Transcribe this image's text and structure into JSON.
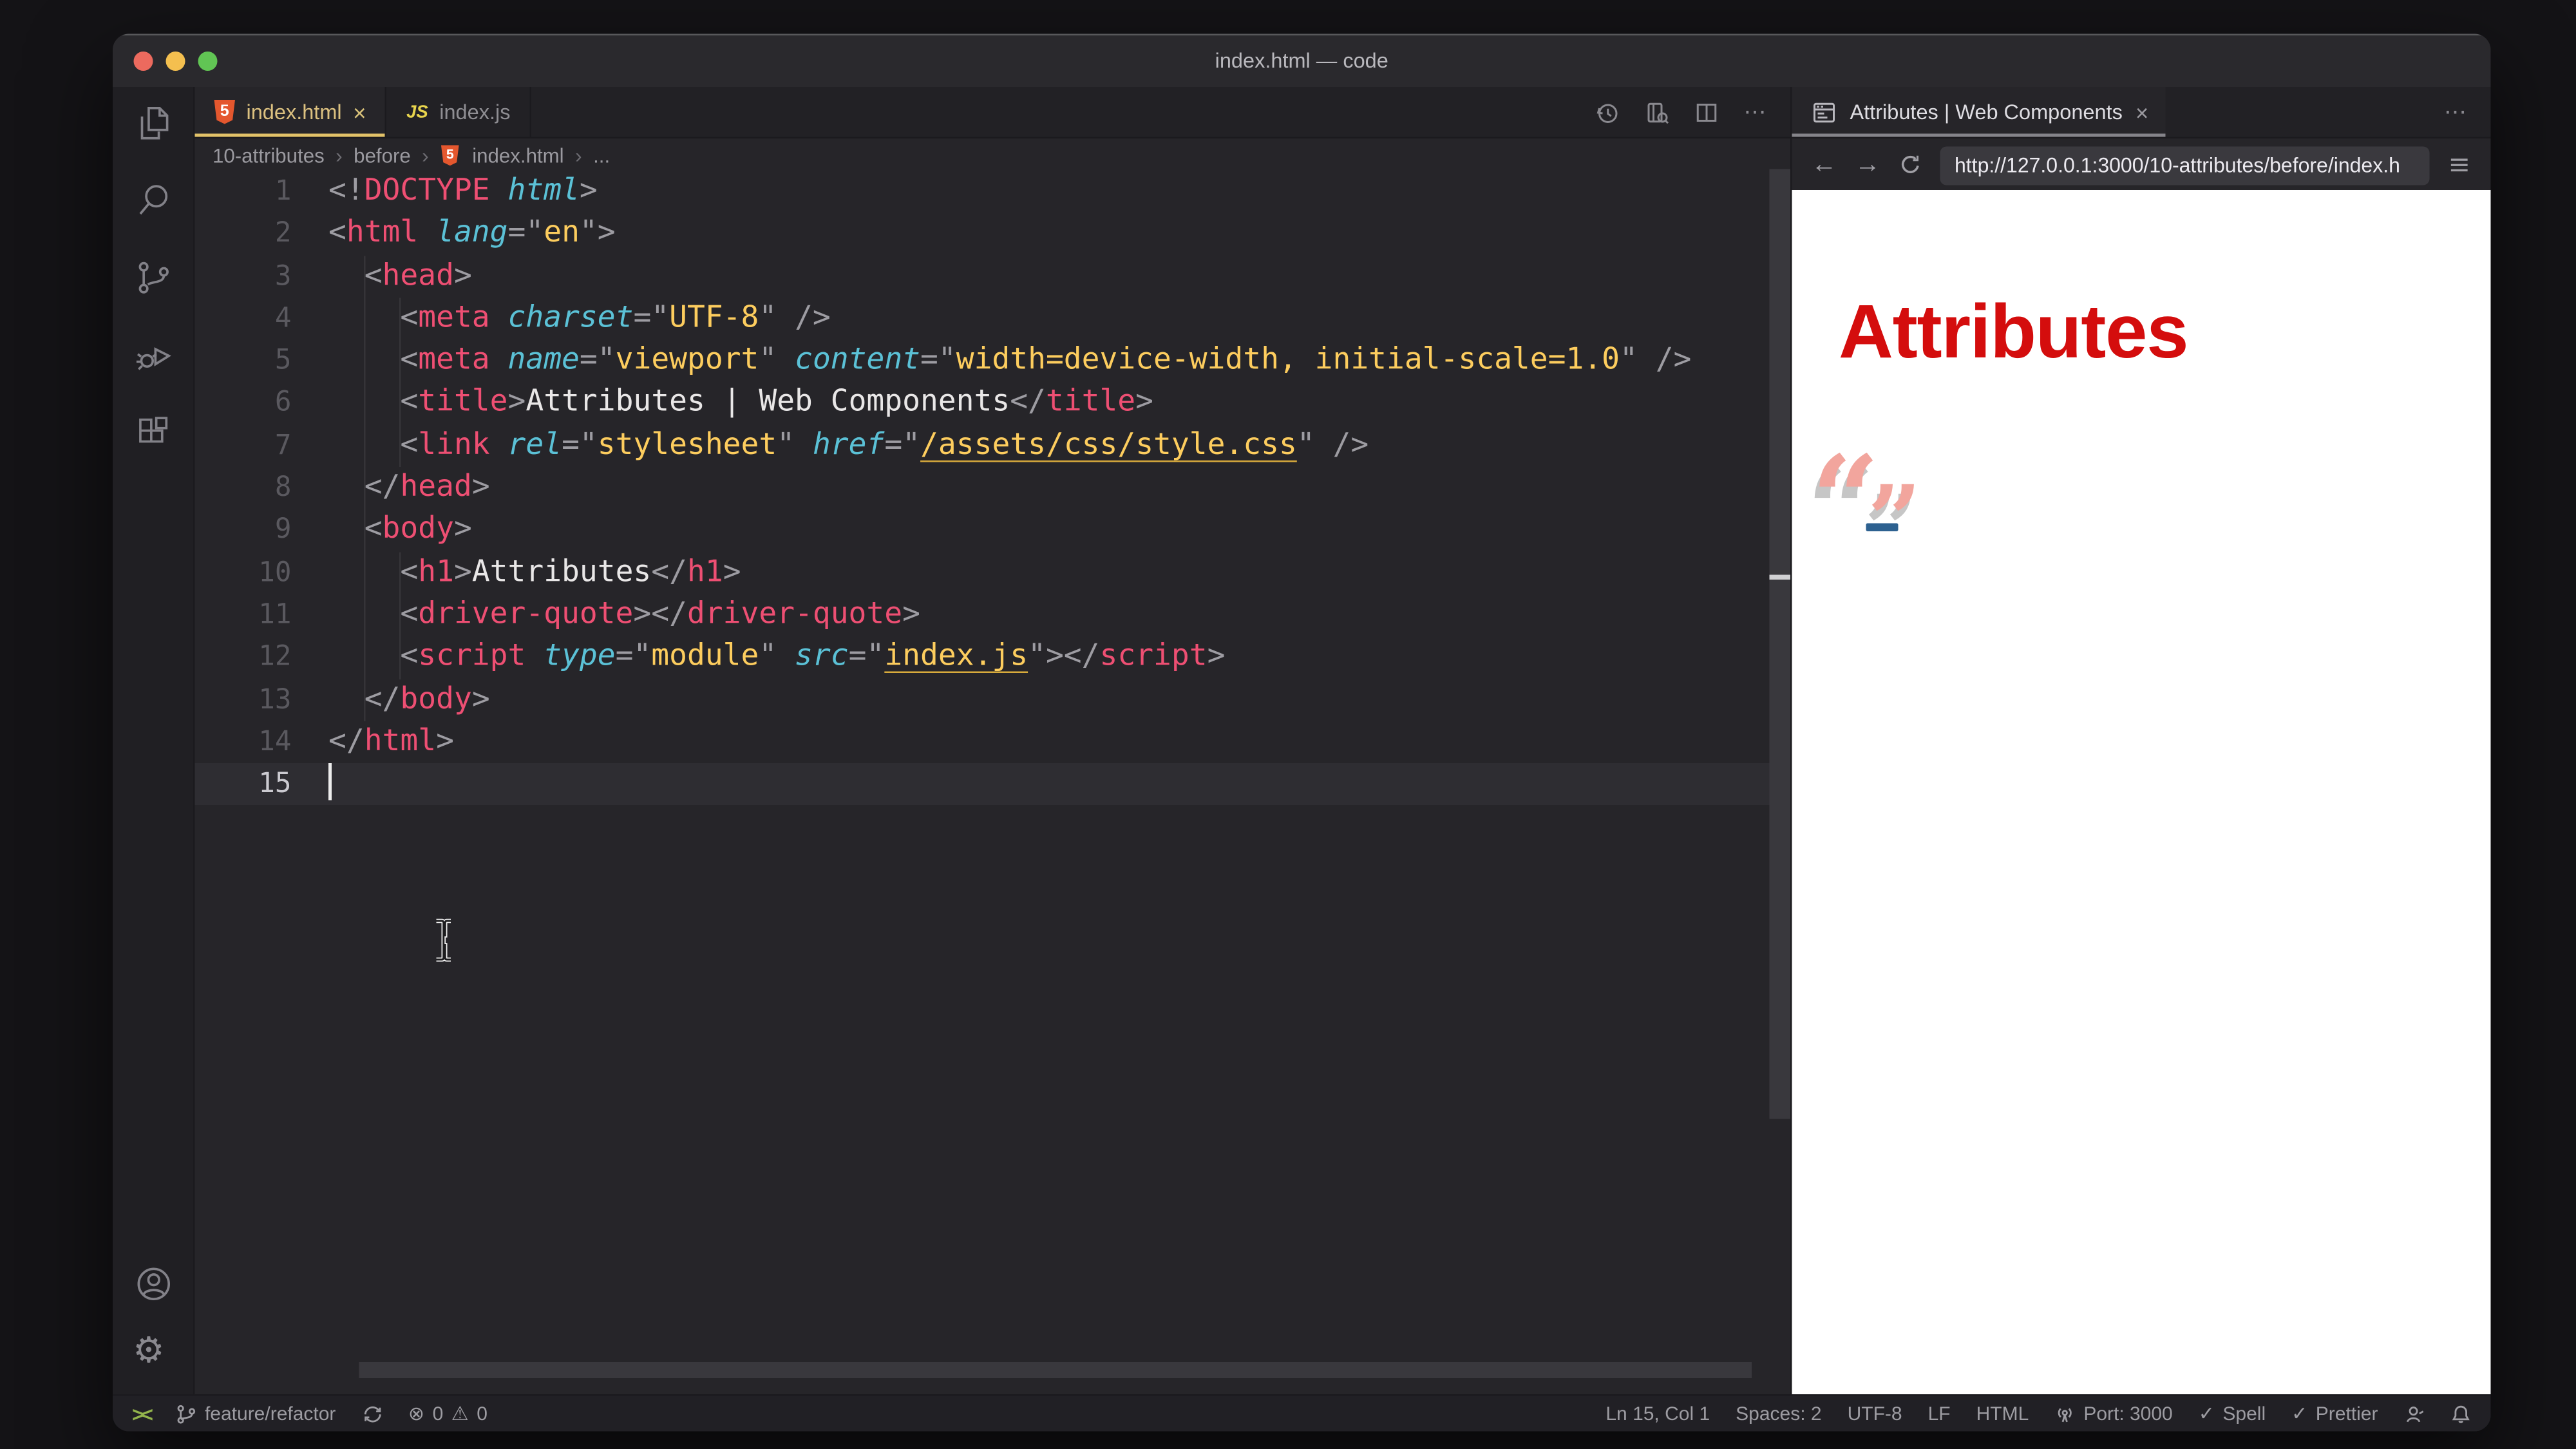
{
  "window": {
    "title": "index.html — code"
  },
  "glyphs": {
    "close": "×",
    "ellipsis": "⋯",
    "back": "←",
    "forward": "→",
    "check": "✓",
    "error": "⊗",
    "warning": "⚠",
    "remote": "><"
  },
  "activity_bar": {
    "icons": [
      "explorer",
      "search",
      "source-control",
      "run-debug",
      "extensions",
      "account",
      "settings"
    ]
  },
  "tabs": [
    {
      "label": "index.html",
      "icon_text": "5",
      "active": true
    },
    {
      "label": "index.js",
      "icon_text": "JS",
      "active": false
    }
  ],
  "breadcrumb": {
    "segments": [
      "10-attributes",
      "before",
      "index.html",
      "..."
    ],
    "separator": "›",
    "icon_text": "5"
  },
  "code": {
    "active_line": 15,
    "lines": [
      {
        "n": 1,
        "tokens": [
          [
            "p",
            "<!"
          ],
          [
            "t",
            "DOCTYPE"
          ],
          [
            "a",
            " html"
          ],
          [
            "p",
            ">"
          ]
        ]
      },
      {
        "n": 2,
        "tokens": [
          [
            "p",
            "<"
          ],
          [
            "t",
            "html"
          ],
          [
            "a",
            " lang"
          ],
          [
            "p",
            "=\""
          ],
          [
            "v",
            "en"
          ],
          [
            "p",
            "\">"
          ]
        ]
      },
      {
        "n": 3,
        "tokens": [
          [
            "p",
            "  <"
          ],
          [
            "t",
            "head"
          ],
          [
            "p",
            ">"
          ]
        ]
      },
      {
        "n": 4,
        "tokens": [
          [
            "p",
            "    <"
          ],
          [
            "t",
            "meta"
          ],
          [
            "a",
            " charset"
          ],
          [
            "p",
            "=\""
          ],
          [
            "v",
            "UTF-8"
          ],
          [
            "p",
            "\" />"
          ]
        ]
      },
      {
        "n": 5,
        "tokens": [
          [
            "p",
            "    <"
          ],
          [
            "t",
            "meta"
          ],
          [
            "a",
            " name"
          ],
          [
            "p",
            "=\""
          ],
          [
            "v",
            "viewport"
          ],
          [
            "p",
            "\""
          ],
          [
            "a",
            " content"
          ],
          [
            "p",
            "=\""
          ],
          [
            "v",
            "width=device-width, initial-scale=1.0"
          ],
          [
            "p",
            "\" />"
          ]
        ]
      },
      {
        "n": 6,
        "tokens": [
          [
            "p",
            "    <"
          ],
          [
            "t",
            "title"
          ],
          [
            "p",
            ">"
          ],
          [
            "x",
            "Attributes | Web Components"
          ],
          [
            "p",
            "</"
          ],
          [
            "t",
            "title"
          ],
          [
            "p",
            ">"
          ]
        ]
      },
      {
        "n": 7,
        "tokens": [
          [
            "p",
            "    <"
          ],
          [
            "t",
            "link"
          ],
          [
            "a",
            " rel"
          ],
          [
            "p",
            "=\""
          ],
          [
            "v",
            "stylesheet"
          ],
          [
            "p",
            "\""
          ],
          [
            "a",
            " href"
          ],
          [
            "p",
            "=\""
          ],
          [
            "l",
            "/assets/css/style.css"
          ],
          [
            "p",
            "\" />"
          ]
        ]
      },
      {
        "n": 8,
        "tokens": [
          [
            "p",
            "  </"
          ],
          [
            "t",
            "head"
          ],
          [
            "p",
            ">"
          ]
        ]
      },
      {
        "n": 9,
        "tokens": [
          [
            "p",
            "  <"
          ],
          [
            "t",
            "body"
          ],
          [
            "p",
            ">"
          ]
        ]
      },
      {
        "n": 10,
        "tokens": [
          [
            "p",
            "    <"
          ],
          [
            "t",
            "h1"
          ],
          [
            "p",
            ">"
          ],
          [
            "x",
            "Attributes"
          ],
          [
            "p",
            "</"
          ],
          [
            "t",
            "h1"
          ],
          [
            "p",
            ">"
          ]
        ]
      },
      {
        "n": 11,
        "tokens": [
          [
            "p",
            "    <"
          ],
          [
            "t",
            "driver-quote"
          ],
          [
            "p",
            "></"
          ],
          [
            "t",
            "driver-quote"
          ],
          [
            "p",
            ">"
          ]
        ]
      },
      {
        "n": 12,
        "tokens": [
          [
            "p",
            "    <"
          ],
          [
            "t",
            "script"
          ],
          [
            "a",
            " type"
          ],
          [
            "p",
            "=\""
          ],
          [
            "v",
            "module"
          ],
          [
            "p",
            "\""
          ],
          [
            "a",
            " src"
          ],
          [
            "p",
            "=\""
          ],
          [
            "l",
            "index.js"
          ],
          [
            "p",
            "\">"
          ],
          [
            "p",
            "</"
          ],
          [
            "t",
            "script"
          ],
          [
            "p",
            ">"
          ]
        ]
      },
      {
        "n": 13,
        "tokens": [
          [
            "p",
            "  </"
          ],
          [
            "t",
            "body"
          ],
          [
            "p",
            ">"
          ]
        ]
      },
      {
        "n": 14,
        "tokens": [
          [
            "p",
            "</"
          ],
          [
            "t",
            "html"
          ],
          [
            "p",
            ">"
          ]
        ]
      },
      {
        "n": 15,
        "tokens": []
      }
    ]
  },
  "browser": {
    "tab_title": "Attributes | Web Components",
    "url": "http://127.0.0.1:3000/10-attributes/before/index.h",
    "page": {
      "heading": "Attributes",
      "quote_open": "“",
      "quote_close": "”"
    }
  },
  "status_bar": {
    "left": {
      "remote_label": "><",
      "branch": "feature/refactor",
      "errors": "0",
      "warnings": "0"
    },
    "right": [
      {
        "label": "Ln 15, Col 1"
      },
      {
        "label": "Spaces: 2"
      },
      {
        "label": "UTF-8"
      },
      {
        "label": "LF"
      },
      {
        "label": "HTML"
      },
      {
        "label": "Port: 3000"
      },
      {
        "label": "Spell"
      },
      {
        "label": "Prettier"
      }
    ]
  },
  "colors": {
    "accent_tab": "#e2c269",
    "tag": "#ee4f73",
    "attribute": "#5bc1d6",
    "value": "#fdcd5e",
    "heading_red": "#d40d0d",
    "quote_salmon": "#f2a59d"
  }
}
